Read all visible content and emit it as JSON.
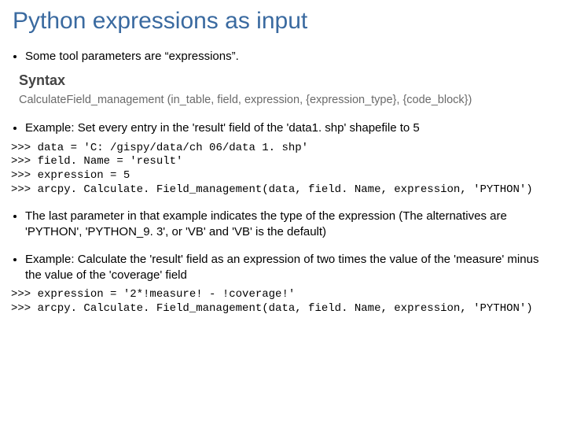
{
  "title": "Python expressions as input",
  "bullet1": "Some tool parameters are “expressions”.",
  "syntax": {
    "heading": "Syntax",
    "signature": "CalculateField_management (in_table, field, expression, {expression_type}, {code_block})"
  },
  "bullet2": "Example:   Set every entry in the 'result' field of the 'data1. shp' shapefile to 5",
  "code1": ">>> data = 'C: /gispy/data/ch 06/data 1. shp'\n>>> field. Name = 'result'\n>>> expression = 5\n>>> arcpy. Calculate. Field_management(data, field. Name, expression, 'PYTHON')",
  "bullet3": "The last parameter in that example indicates the type of the expression (The alternatives are 'PYTHON', 'PYTHON_9. 3', or 'VB' and 'VB' is the default)",
  "bullet4": "Example: Calculate the 'result' field as an expression of two times the value of the 'measure' minus the value of the 'coverage' field",
  "code2": ">>> expression = '2*!measure! - !coverage!'\n>>> arcpy. Calculate. Field_management(data, field. Name, expression, 'PYTHON')"
}
